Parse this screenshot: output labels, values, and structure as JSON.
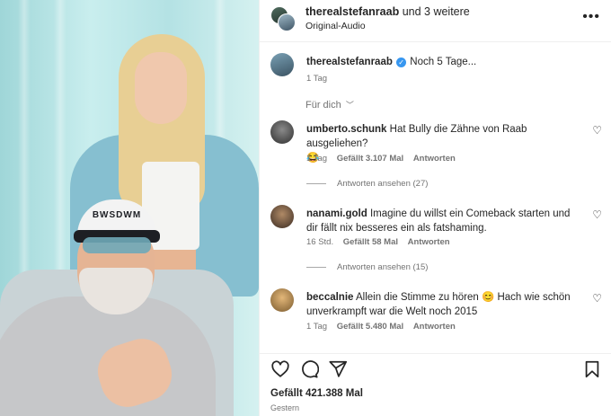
{
  "media": {
    "cap_text": "BWSDWM"
  },
  "header": {
    "username": "therealstefanraab",
    "and_others": "und 3 weitere",
    "audio": "Original-Audio",
    "more_icon": "more-dots-icon"
  },
  "caption": {
    "username": "therealstefanraab",
    "verified_icon": "verified-badge-icon",
    "text": "Noch 5 Tage...",
    "time": "1 Tag"
  },
  "sort_label": "Für dich",
  "comments": [
    {
      "username": "umberto.schunk",
      "text": "Hat Bully die Zähne von Raab ausgeliehen?",
      "emoji": "😂",
      "time": "1 Tag",
      "likes": "Gefällt 3.107 Mal",
      "reply": "Antworten",
      "view_replies": "Antworten ansehen (27)"
    },
    {
      "username": "nanami.gold",
      "text": "Imagine du willst ein Comeback starten und dir fällt nix besseres ein als fatshaming.",
      "time": "16 Std.",
      "likes": "Gefällt 58 Mal",
      "reply": "Antworten",
      "view_replies": "Antworten ansehen (15)"
    },
    {
      "username": "beccalnie",
      "text": "Allein die Stimme zu hören 😊 Hach wie schön unverkrampft war die Welt noch 2015",
      "time": "1 Tag",
      "likes": "Gefällt 5.480 Mal",
      "reply": "Antworten"
    }
  ],
  "footer": {
    "likes": "Gefällt 421.388 Mal",
    "date": "Gestern",
    "icons": [
      "heart-icon",
      "comment-icon",
      "share-icon",
      "bookmark-icon"
    ]
  },
  "colors": {
    "verified": "#3897f0",
    "muted": "#737373",
    "text": "#262626"
  }
}
